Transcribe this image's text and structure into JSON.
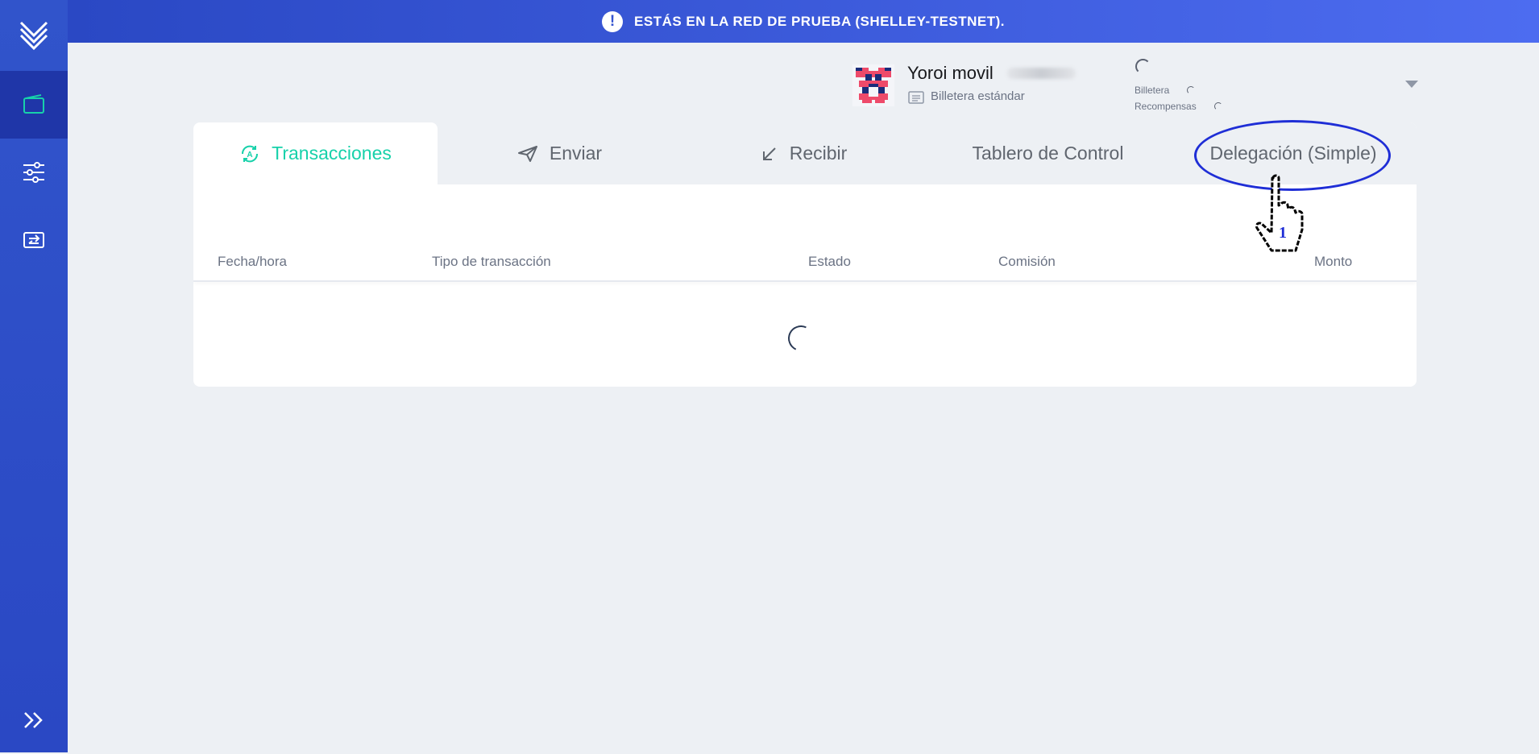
{
  "banner": {
    "text": "ESTÁS EN LA RED DE PRUEBA (SHELLEY-TESTNET).",
    "icon": "exclamation-icon"
  },
  "sidebar": {
    "items": [
      {
        "icon": "yoroi-logo-icon",
        "active": false
      },
      {
        "icon": "wallet-icon",
        "active": true
      },
      {
        "icon": "settings-sliders-icon",
        "active": false
      },
      {
        "icon": "transfer-icon",
        "active": false
      }
    ],
    "expand_icon": "chevron-double-right-icon"
  },
  "wallet": {
    "name": "Yoroi movil",
    "type": "Billetera estándar",
    "balance_label": "Billetera",
    "rewards_label": "Recompensas"
  },
  "tabs": [
    {
      "label": "Transacciones",
      "icon": "transactions-icon",
      "active": true
    },
    {
      "label": "Enviar",
      "icon": "send-icon",
      "active": false
    },
    {
      "label": "Recibir",
      "icon": "receive-arrow-icon",
      "active": false
    },
    {
      "label": "Tablero de Control",
      "icon": "",
      "active": false
    },
    {
      "label": "Delegación (Simple)",
      "icon": "",
      "active": false
    }
  ],
  "table": {
    "headers": [
      "Fecha/hora",
      "Tipo de transacción",
      "Estado",
      "Comisión",
      "Monto"
    ]
  },
  "annotation": {
    "step": "1"
  },
  "colors": {
    "accent": "#17d1aa",
    "sidebar": "#2a48c4",
    "annotation": "#1f2ed6"
  }
}
